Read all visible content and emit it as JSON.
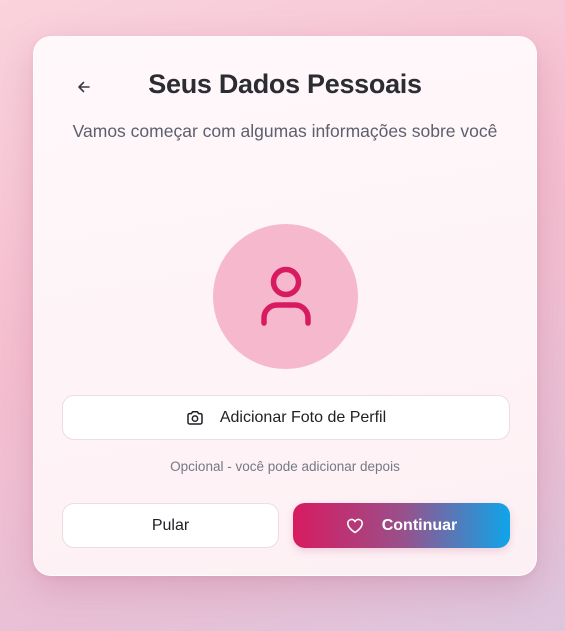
{
  "header": {
    "title": "Seus Dados Pessoais",
    "subtitle": "Vamos começar com algumas informações sobre você"
  },
  "profile": {
    "avatar_icon": "user-icon",
    "photo_button_label": "Adicionar Foto de Perfil",
    "photo_button_icon": "camera-icon",
    "hint": "Opcional - você pode adicionar depois"
  },
  "actions": {
    "skip_label": "Pular",
    "continue_label": "Continuar",
    "continue_icon": "heart-icon"
  },
  "colors": {
    "accent": "#d81b60",
    "gradient_end": "#0ea5e9",
    "avatar_bg": "#f6b8cc"
  }
}
